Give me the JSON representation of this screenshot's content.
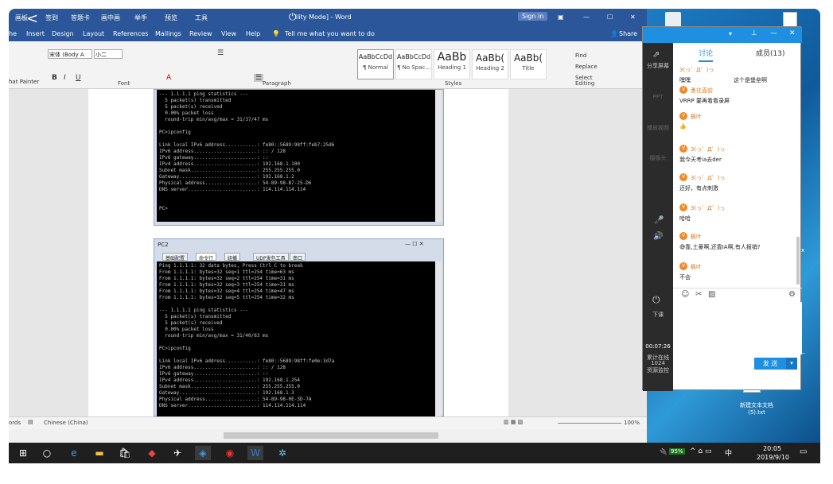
{
  "word": {
    "qat": [
      "画板",
      "签到",
      "答题卡",
      "画中画",
      "举手",
      "预览",
      "工具"
    ],
    "title": "ility Mode] - Word",
    "signin": "Sign in",
    "tabs": [
      "he",
      "Insert",
      "Design",
      "Layout",
      "References",
      "Mailings",
      "Review",
      "View",
      "Help",
      "Tell me what you want to do"
    ],
    "share": "Share",
    "format_painter": "hat Painter",
    "font_name": "宋体 (Body A",
    "font_size": "小二",
    "groups": {
      "font": "Font",
      "paragraph": "Paragraph",
      "styles": "Styles",
      "editing": "Editing"
    },
    "styles": [
      {
        "preview": "AaBbCcDd",
        "label": "¶ Normal"
      },
      {
        "preview": "AaBbCcDd",
        "label": "¶ No Spac..."
      },
      {
        "preview": "AaBb",
        "label": "Heading 1"
      },
      {
        "preview": "AaBb(",
        "label": "Heading 2"
      },
      {
        "preview": "AaBb(",
        "label": "Title"
      }
    ],
    "editing": {
      "find": "Find",
      "replace": "Replace",
      "select": "Select"
    },
    "status": {
      "words": "ords",
      "language": "Chinese (China)",
      "zoom": "100%"
    }
  },
  "pc1_text": "--- 1.1.1.1 ping statistics ---\n  5 packet(s) transmitted\n  5 packet(s) received\n  0.00% packet loss\n  round-trip min/avg/max = 31/37/47 ms\n\nPC>ipconfig\n\nLink local IPv6 address...........: fe80::5689:98ff:feb7:25d6\nIPv6 address......................: :: / 128\nIPv6 gateway......................: ::\nIPv4 address......................: 192.168.1.100\nSubnet mask.......................: 255.255.255.0\nGateway...........................: 192.168.1.2\nPhysical address..................: 54-89-98-B7-25-D6\nDNS server........................: 114.114.114.114\n\n\nPC>",
  "pc2": {
    "title": "PC2",
    "tabs": [
      "基础配置",
      "命令行",
      "组播",
      "UDP发包工具",
      "串口"
    ],
    "text": "Ping 1.1.1.1: 32 data bytes, Press Ctrl_C to break\nFrom 1.1.1.1: bytes=32 seq=1 ttl=254 time=63 ms\nFrom 1.1.1.1: bytes=32 seq=2 ttl=254 time=31 ms\nFrom 1.1.1.1: bytes=32 seq=3 ttl=254 time=31 ms\nFrom 1.1.1.1: bytes=32 seq=4 ttl=254 time=47 ms\nFrom 1.1.1.1: bytes=32 seq=5 ttl=254 time=32 ms\n\n--- 1.1.1.1 ping statistics ---\n  5 packet(s) transmitted\n  5 packet(s) received\n  0.00% packet loss\n  round-trip min/avg/max = 31/40/63 ms\n\nPC>ipconfig\n\nLink local IPv6 address...........: fe80::5689:98ff:fe0e:3d7a\nIPv6 address......................: :: / 128\nIPv6 gateway......................: ::\nIPv4 address......................: 192.168.1.254\nSubnet mask.......................: 255.255.255.0\nGateway...........................: 192.168.1.3\nPhysical address..................: 54-89-98-0E-3D-7A\nDNS server........................: 114.114.114.114"
  },
  "panel": {
    "tabs": [
      "讨论",
      "成员(13)"
    ],
    "side": [
      "分享屏幕",
      "PPT",
      "播放视频",
      "摄像头",
      "下课",
      "00:07:26",
      "累计在线",
      "1024",
      "资源监控"
    ],
    "first_msg": {
      "nick": "3(っ゜Д゜)っ",
      "text1": "嘿嘿",
      "text2": "这个是堡垒啊"
    },
    "messages": [
      {
        "nick": "勇往直前",
        "text": "VRRP 要再看看录屏"
      },
      {
        "nick": "枫叶",
        "text": "👍"
      },
      {
        "nick": "3(っ゜Д゜)っ",
        "text": "我今天考ia去der"
      },
      {
        "nick": "3(っ゜Д゜)っ",
        "text": "还好，有点刺激"
      },
      {
        "nick": "3(っ゜Д゜)っ",
        "text": "哈哈"
      },
      {
        "nick": "枫叶",
        "text": "😅靠,土豪啊,还靠IA啊,有人报销?"
      },
      {
        "nick": "枫叶",
        "text": "不会"
      }
    ],
    "send": "发 送"
  },
  "desktop": {
    "file": "新建文本文档\n(5).txt",
    "partial": "--",
    "partial2": "x"
  },
  "taskbar": {
    "battery": "95%",
    "ime": "中",
    "time": "20:05",
    "date": "2019/9/10"
  }
}
